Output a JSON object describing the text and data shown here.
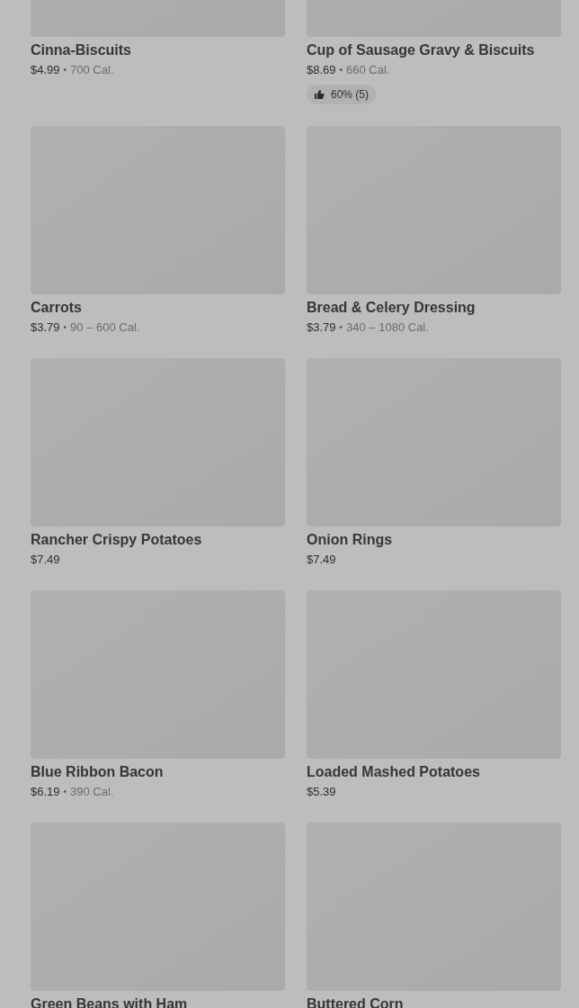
{
  "menu_items": [
    {
      "name": "Cinna-Biscuits",
      "price": "$4.99",
      "separator": "•",
      "calories": "700 Cal."
    },
    {
      "name": "Cup of Sausage Gravy & Biscuits",
      "price": "$8.69",
      "separator": "•",
      "calories": "660 Cal.",
      "rating": "60% (5)"
    },
    {
      "name": "Carrots",
      "price": "$3.79",
      "separator": "•",
      "calories": "90 – 600 Cal."
    },
    {
      "name": "Bread & Celery Dressing",
      "price": "$3.79",
      "separator": "•",
      "calories": "340 – 1080 Cal."
    },
    {
      "name": "Rancher Crispy Potatoes",
      "price": "$7.49"
    },
    {
      "name": "Onion Rings",
      "price": "$7.49"
    },
    {
      "name": "Blue Ribbon Bacon",
      "price": "$6.19",
      "separator": "•",
      "calories": "390 Cal."
    },
    {
      "name": "Loaded Mashed Potatoes",
      "price": "$5.39"
    },
    {
      "name": "Green Beans with Ham"
    },
    {
      "name": "Buttered Corn"
    }
  ]
}
